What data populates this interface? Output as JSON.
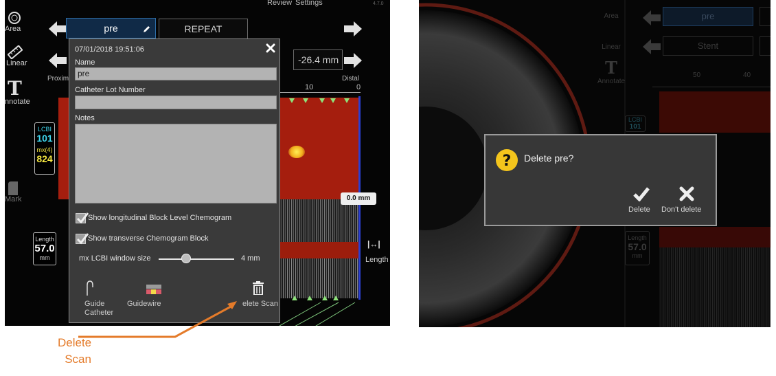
{
  "top_menu": {
    "review": "Review",
    "settings": "Settings",
    "version": "4.7.0"
  },
  "left_toolbar": {
    "area_label": "Area",
    "linear_label": "Linear",
    "annotate_label": "nnotate",
    "mark_label": "Mark"
  },
  "scan_tabs": {
    "active": "pre",
    "second": "REPEAT"
  },
  "measure": {
    "value": "-26.4 mm",
    "proximal": "Proxim",
    "distal": "Distal",
    "tick_10": "10",
    "tick_0": "0"
  },
  "lcbi": {
    "label": "LCBI",
    "value": "101",
    "mx_label": "mx(4)",
    "mx_value": "824"
  },
  "length_box": {
    "label": "Length",
    "value": "57.0",
    "unit": "mm"
  },
  "cursor_readout": "0.0 mm",
  "length_side": {
    "icon_text": "|↔|",
    "label": "Length"
  },
  "dialog": {
    "timestamp": "07/01/2018 19:51:06",
    "name_label": "Name",
    "name_value": "pre",
    "lot_label": "Catheter Lot Number",
    "lot_value": "",
    "notes_label": "Notes",
    "notes_value": "",
    "check1_label": "Show longitudinal Block Level Chemogram",
    "check2_label": "Show transverse Chemogram Block",
    "slider_label": "mx LCBI window size",
    "slider_value": "4 mm",
    "slider_fraction": 0.36,
    "guide_catheter_label_1": "Guide",
    "guide_catheter_label_2": "Catheter",
    "guidewire_label": "Guidewire",
    "delete_scan_label": "elete Scan"
  },
  "callout": {
    "line1": "Delete",
    "line2": "Scan"
  },
  "right_panel": {
    "area_label": "Area",
    "linear_label": "Linear",
    "annotate_label": "Annotate",
    "tab_pre": "pre",
    "tab_stent": "Stent",
    "tick_50": "50",
    "tick_40": "40",
    "lcbi_label": "LCBI",
    "lcbi_value": "101",
    "length_label": "Length",
    "length_value": "57.0",
    "length_unit": "mm"
  },
  "confirm_dialog": {
    "question": "Delete pre?",
    "delete_label": "Delete",
    "dont_delete_label": "Don't delete"
  },
  "colors": {
    "accent_orange": "#e47b2a",
    "lcbi_cyan": "#3fd8f0",
    "mx_yellow": "#f4e640",
    "chemogram_red": "#a51e0e",
    "cursor_blue": "#2b3fd1"
  }
}
